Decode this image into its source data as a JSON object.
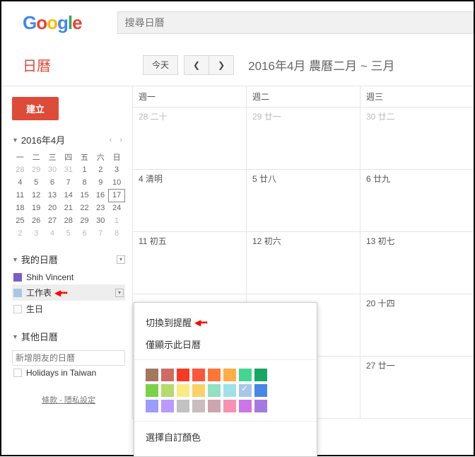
{
  "logo_text": "Google",
  "search": {
    "placeholder": "搜尋日曆"
  },
  "app_title": "日曆",
  "toolbar": {
    "today": "今天",
    "prev": "❮",
    "next": "❯",
    "date_title": "2016年4月 農曆二月 ~ 三月"
  },
  "create_label": "建立",
  "mini": {
    "title": "2016年4月",
    "dow": [
      "一",
      "二",
      "三",
      "四",
      "五",
      "六",
      "日"
    ],
    "weeks": [
      [
        {
          "d": "28",
          "o": 1
        },
        {
          "d": "29",
          "o": 1
        },
        {
          "d": "30",
          "o": 1
        },
        {
          "d": "31",
          "o": 1
        },
        {
          "d": "1"
        },
        {
          "d": "2"
        },
        {
          "d": "3"
        }
      ],
      [
        {
          "d": "4"
        },
        {
          "d": "5"
        },
        {
          "d": "6"
        },
        {
          "d": "7"
        },
        {
          "d": "8"
        },
        {
          "d": "9"
        },
        {
          "d": "10"
        }
      ],
      [
        {
          "d": "11"
        },
        {
          "d": "12"
        },
        {
          "d": "13"
        },
        {
          "d": "14"
        },
        {
          "d": "15"
        },
        {
          "d": "16"
        },
        {
          "d": "17",
          "t": 1
        }
      ],
      [
        {
          "d": "18"
        },
        {
          "d": "19"
        },
        {
          "d": "20"
        },
        {
          "d": "21"
        },
        {
          "d": "22"
        },
        {
          "d": "23"
        },
        {
          "d": "24"
        }
      ],
      [
        {
          "d": "25"
        },
        {
          "d": "26"
        },
        {
          "d": "27"
        },
        {
          "d": "28"
        },
        {
          "d": "29"
        },
        {
          "d": "30"
        },
        {
          "d": "1",
          "o": 1
        }
      ],
      [
        {
          "d": "2",
          "o": 1
        },
        {
          "d": "3",
          "o": 1
        },
        {
          "d": "4",
          "o": 1
        },
        {
          "d": "5",
          "o": 1
        },
        {
          "d": "6",
          "o": 1
        },
        {
          "d": "7",
          "o": 1
        },
        {
          "d": "8",
          "o": 1
        }
      ]
    ]
  },
  "sections": {
    "my": {
      "title": "我的日曆",
      "items": [
        {
          "label": "Shih Vincent",
          "color": "#7A5EC7",
          "checked": true
        },
        {
          "label": "工作表",
          "color": "#A7C7E7",
          "checked": true,
          "selected": true,
          "arrow": "◀•••"
        },
        {
          "label": "生日",
          "color": "",
          "checked": false
        }
      ]
    },
    "other": {
      "title": "其他日曆",
      "add_placeholder": "新增朋友的日曆",
      "items": [
        {
          "label": "Holidays in Taiwan",
          "color": "",
          "checked": false
        }
      ]
    }
  },
  "footer": {
    "terms": "條款",
    "sep": " - ",
    "privacy": "隱私設定"
  },
  "grid": {
    "headers": [
      "週一",
      "週二",
      "週三"
    ],
    "rows": [
      [
        {
          "t": "28 二十",
          "o": 1
        },
        {
          "t": "29 廿一",
          "o": 1
        },
        {
          "t": "30 廿二",
          "o": 1
        }
      ],
      [
        {
          "t": "4 清明"
        },
        {
          "t": "5 廿八"
        },
        {
          "t": "6 廿九"
        }
      ],
      [
        {
          "t": "11 初五"
        },
        {
          "t": "12 初六"
        },
        {
          "t": "13 初七"
        }
      ],
      [
        {
          "t": ""
        },
        {
          "t": ""
        },
        {
          "t": "20 十四"
        }
      ],
      [
        {
          "t": ""
        },
        {
          "t": ""
        },
        {
          "t": "27 廿一"
        }
      ]
    ]
  },
  "popup": {
    "switch": "切換到提醒",
    "arrow": "◀•••",
    "only": "僅顯示此日曆",
    "custom": "選擇自訂顏色",
    "colors": [
      "#A47760",
      "#D06B64",
      "#F83A22",
      "#FA573C",
      "#FF7537",
      "#FFAD46",
      "#42D692",
      "#16A765",
      "#7BD148",
      "#B3DC6C",
      "#FBE983",
      "#FAD165",
      "#92E1C0",
      "#9FE1E7",
      "#A7C7E7",
      "#4986E7",
      "#9A9CFF",
      "#B99AFF",
      "#C2C2C2",
      "#CABDBF",
      "#CCA6AC",
      "#F691B2",
      "#CD74E6",
      "#A47AE2"
    ],
    "checked_index": 14
  }
}
